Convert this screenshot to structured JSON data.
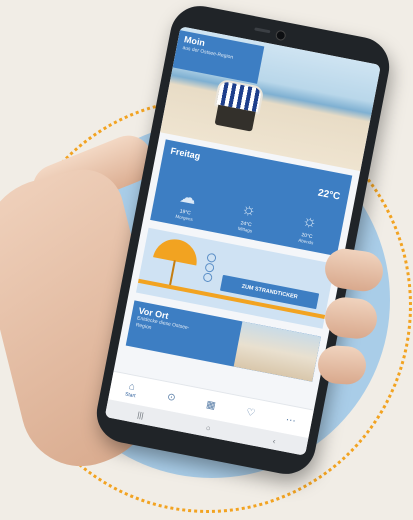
{
  "colors": {
    "brand_blue": "#3d7ec3",
    "accent_orange": "#f2a321",
    "disc_blue": "#a9cde8"
  },
  "hero": {
    "title": "Moin",
    "subtitle": "aus der Ostsee-Region"
  },
  "weather": {
    "day": "Freitag",
    "current_temp": "22°C",
    "slots": [
      {
        "icon": "cloud-icon",
        "temp": "19°C",
        "label": "Morgens"
      },
      {
        "icon": "sun-icon",
        "temp": "24°C",
        "label": "Mittags"
      },
      {
        "icon": "sun-icon",
        "temp": "20°C",
        "label": "Abends"
      }
    ]
  },
  "ticker": {
    "button_label": "ZUM STRANDTICKER"
  },
  "vor_ort": {
    "title": "Vor Ort",
    "subtitle": "Entdecke diese Ostsee-Region"
  },
  "bottom_nav": [
    {
      "icon": "home-icon",
      "label": "Start"
    },
    {
      "icon": "location-pin-icon",
      "label": ""
    },
    {
      "icon": "calendar-icon",
      "label": ""
    },
    {
      "icon": "heart-icon",
      "label": ""
    },
    {
      "icon": "more-icon",
      "label": ""
    }
  ]
}
